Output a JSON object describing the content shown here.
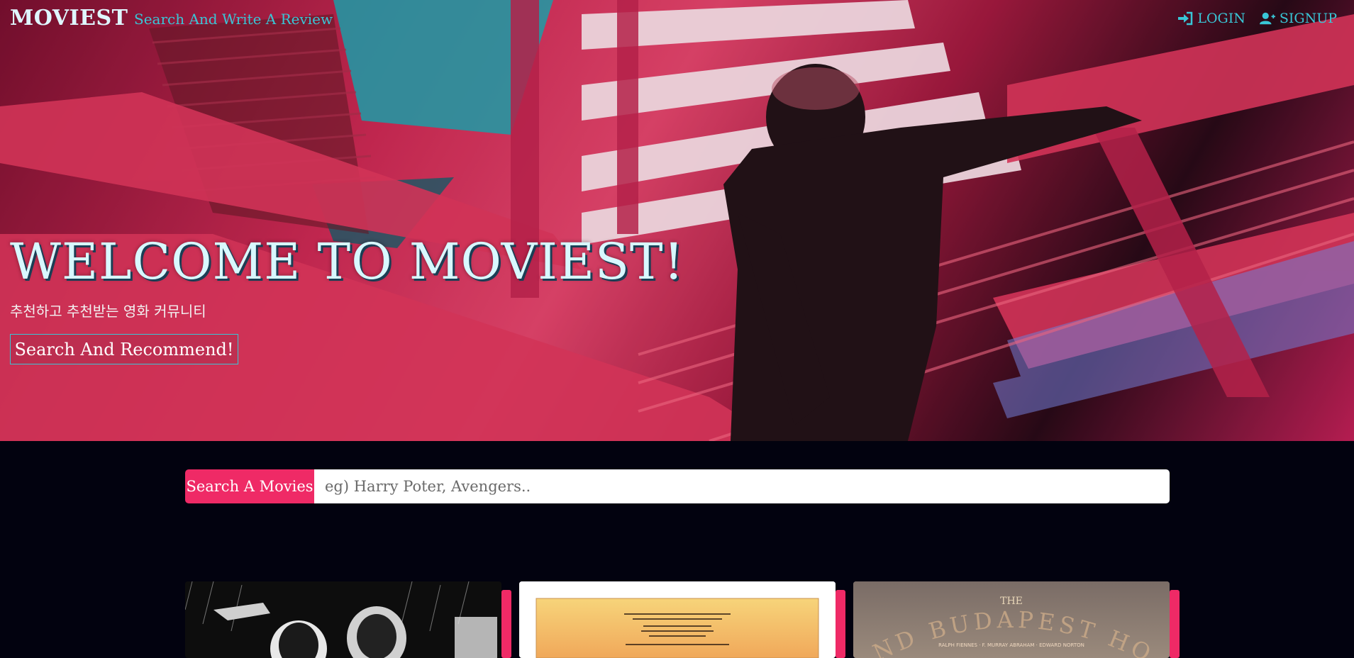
{
  "navbar": {
    "brand": "MOVIEST",
    "link": "Search And Write A Review",
    "login_label": "LOGIN",
    "signup_label": "SIGNUP",
    "login_icon": "sign-in-icon",
    "signup_icon": "user-plus-icon"
  },
  "hero": {
    "title": "WELCOME TO MOVIEST!",
    "subtitle": "추천하고 추천받는 영화 커뮤니티",
    "button_label": "Search And Recommend!"
  },
  "search": {
    "label": "Search A Movies",
    "placeholder": "eg) Harry Poter, Avengers..",
    "value": ""
  },
  "cards": [
    {
      "poster": "sin-city-poster"
    },
    {
      "poster": "last-emperor-poster",
      "text": "He was the Lord of Ten Thousand Years, the absolute monarch of China. He was born to rule a world of ancient tradition. Nothing prepared him for our world of change."
    },
    {
      "poster": "grand-budapest-hotel-poster",
      "title_small": "THE",
      "title": "GRAND BUDAPEST HOTEL",
      "cast": "RALPH FIENNES · F. MURRAY ABRAHAM · EDWARD NORTON"
    }
  ],
  "colors": {
    "accent": "#ef2a66",
    "teal": "#39c6d6",
    "background": "#02020f"
  }
}
